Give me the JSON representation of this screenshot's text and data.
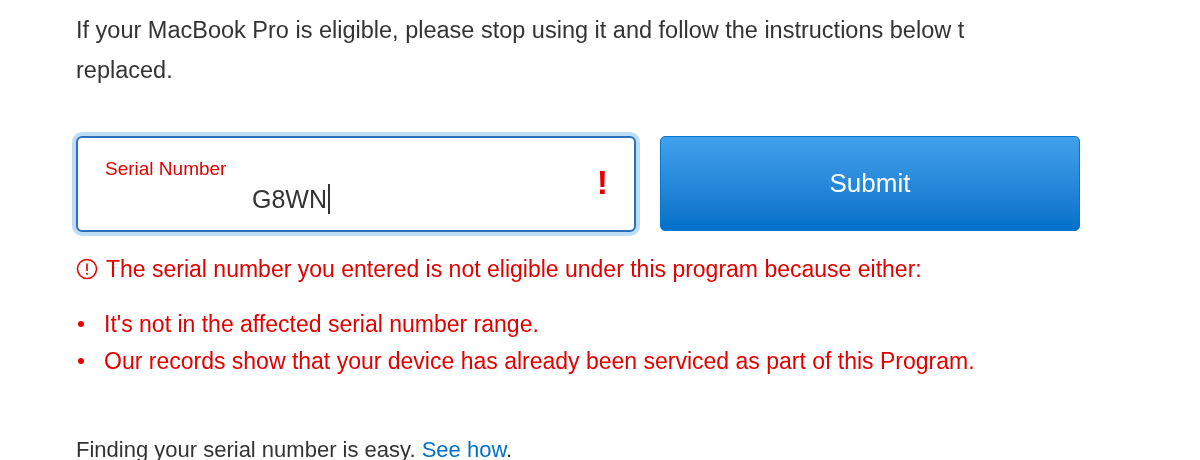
{
  "intro_lines": [
    "If your MacBook Pro is eligible, please stop using it and follow the instructions below t",
    "replaced."
  ],
  "serial_field": {
    "label": "Serial Number",
    "value": "G8WN",
    "error": true,
    "focused": true,
    "error_mark": "!"
  },
  "submit_button": {
    "label": "Submit"
  },
  "error": {
    "message": "The serial number you entered is not eligible under this program because either:",
    "reasons": [
      "It's not in the affected serial number range.",
      "Our records show that your device has already been serviced as part of this Program."
    ]
  },
  "footer": {
    "text": "Finding your serial number is easy.",
    "link": "See how",
    "end": "."
  }
}
